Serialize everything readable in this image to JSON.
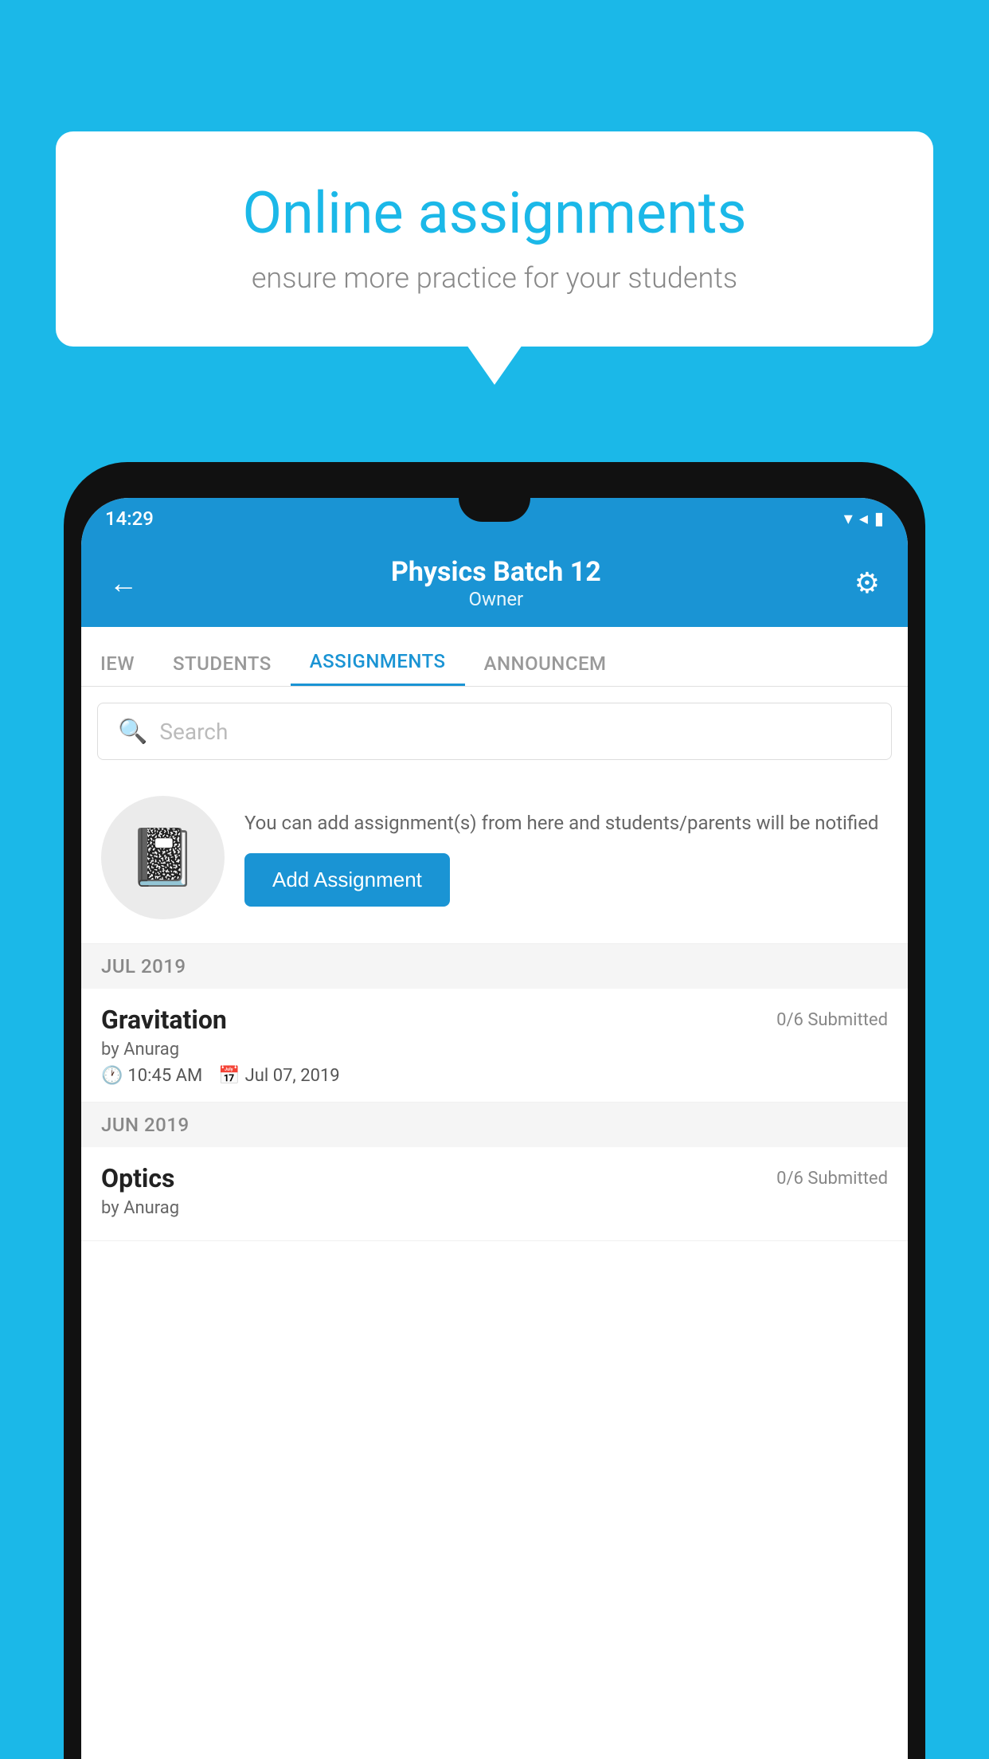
{
  "background": {
    "color": "#1bb8e8"
  },
  "speech_bubble": {
    "title": "Online assignments",
    "subtitle": "ensure more practice for your students"
  },
  "status_bar": {
    "time": "14:29",
    "icons": "▾◂▮"
  },
  "app_bar": {
    "title": "Physics Batch 12",
    "subtitle": "Owner",
    "back_label": "←",
    "settings_label": "⚙"
  },
  "tabs": [
    {
      "label": "IEW",
      "active": false
    },
    {
      "label": "STUDENTS",
      "active": false
    },
    {
      "label": "ASSIGNMENTS",
      "active": true
    },
    {
      "label": "ANNOUNCEM",
      "active": false
    }
  ],
  "search": {
    "placeholder": "Search"
  },
  "promo": {
    "description": "You can add assignment(s) from here and students/parents will be notified",
    "button_label": "Add Assignment"
  },
  "sections": [
    {
      "month": "JUL 2019",
      "assignments": [
        {
          "name": "Gravitation",
          "submitted": "0/6 Submitted",
          "by": "by Anurag",
          "time": "10:45 AM",
          "date": "Jul 07, 2019"
        }
      ]
    },
    {
      "month": "JUN 2019",
      "assignments": [
        {
          "name": "Optics",
          "submitted": "0/6 Submitted",
          "by": "by Anurag",
          "time": "",
          "date": ""
        }
      ]
    }
  ]
}
